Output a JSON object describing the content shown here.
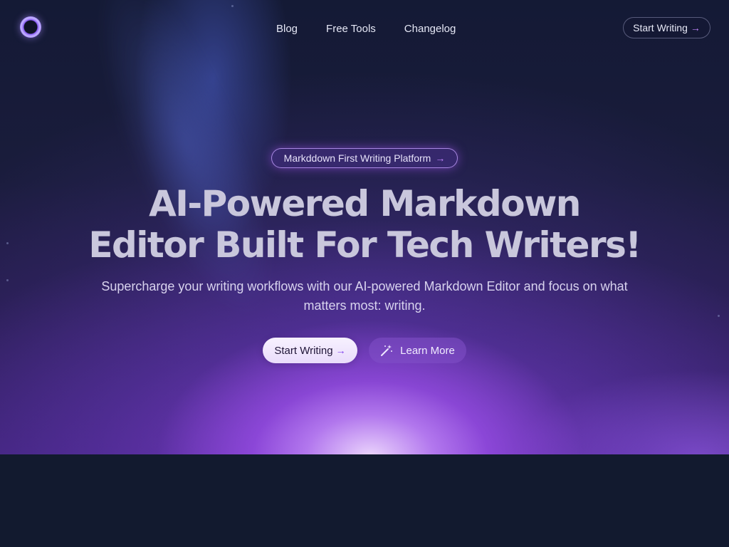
{
  "nav": {
    "logo_icon": "ring-logo-icon",
    "links": [
      {
        "label": "Blog"
      },
      {
        "label": "Free Tools"
      },
      {
        "label": "Changelog"
      }
    ],
    "cta_label": "Start Writing",
    "cta_icon": "arrow-right-icon"
  },
  "hero": {
    "badge_label": "Markddown First Writing Platform",
    "badge_icon": "arrow-right-icon",
    "headline_line1": "AI-Powered Markdown",
    "headline_line2": "Editor Built For Tech Writers!",
    "subtext": "Supercharge your writing workflows with our AI-powered Markdown Editor and focus on what matters most: writing.",
    "primary_button_label": "Start Writing",
    "primary_button_icon": "arrow-right-icon",
    "secondary_button_label": "Learn More",
    "secondary_button_icon": "magic-wand-icon"
  },
  "colors": {
    "background": "#121a2f",
    "accent": "#a855f7",
    "accent_light": "#c084fc",
    "headline_text": "#c9c7dc"
  }
}
